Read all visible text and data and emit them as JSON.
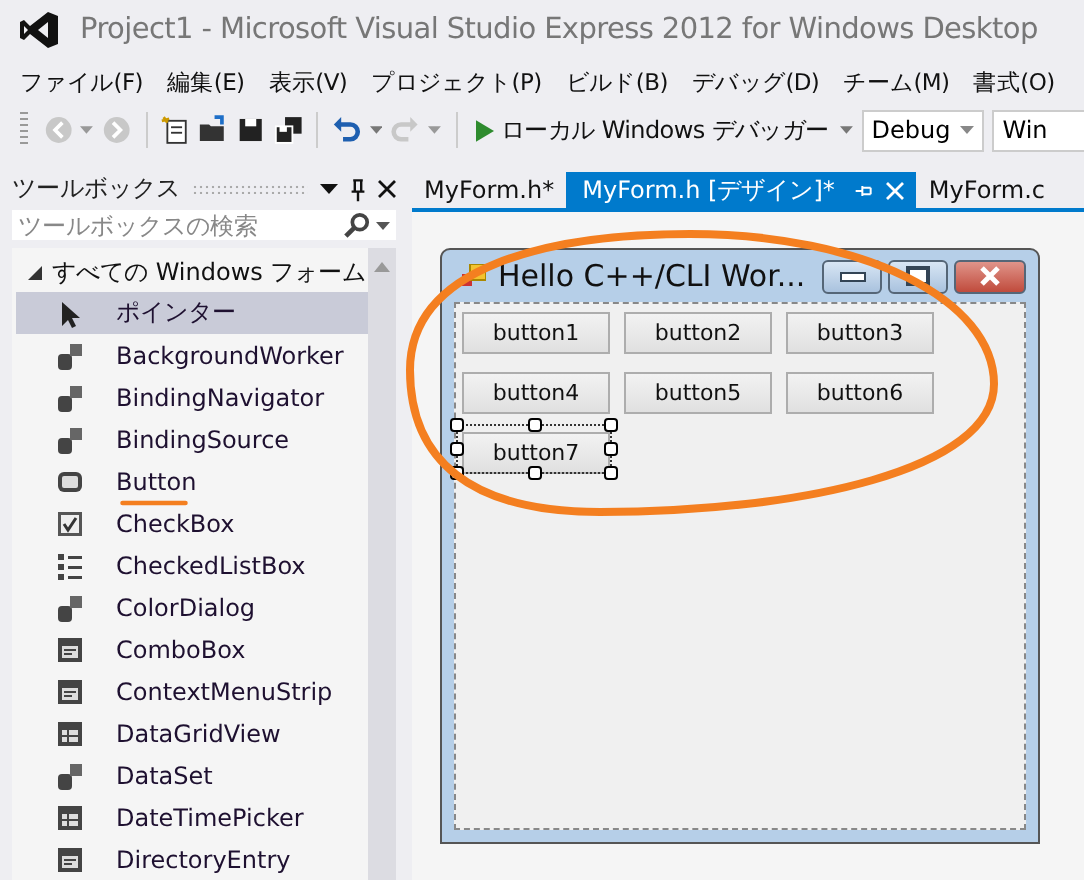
{
  "window": {
    "title": "Project1 - Microsoft Visual Studio Express 2012 for Windows Desktop"
  },
  "menu": [
    "ファイル(F)",
    "編集(E)",
    "表示(V)",
    "プロジェクト(P)",
    "ビルド(B)",
    "デバッグ(D)",
    "チーム(M)",
    "書式(O)"
  ],
  "toolbar": {
    "debugger": "ローカル Windows デバッガー",
    "configuration": "Debug",
    "platform": "Win"
  },
  "toolbox": {
    "title": "ツールボックス",
    "search": {
      "placeholder": "ツールボックスの検索"
    },
    "group": {
      "label": "すべての Windows フォーム",
      "expanded": true
    },
    "items": [
      {
        "label": "ポインター",
        "kind": "pointer",
        "selected": true
      },
      {
        "label": "BackgroundWorker",
        "kind": "component",
        "selected": false
      },
      {
        "label": "BindingNavigator",
        "kind": "component",
        "selected": false
      },
      {
        "label": "BindingSource",
        "kind": "component",
        "selected": false
      },
      {
        "label": "Button",
        "kind": "button",
        "selected": false
      },
      {
        "label": "CheckBox",
        "kind": "checkbox",
        "selected": false
      },
      {
        "label": "CheckedListBox",
        "kind": "list",
        "selected": false
      },
      {
        "label": "ColorDialog",
        "kind": "component",
        "selected": false
      },
      {
        "label": "ComboBox",
        "kind": "form",
        "selected": false
      },
      {
        "label": "ContextMenuStrip",
        "kind": "form",
        "selected": false
      },
      {
        "label": "DataGridView",
        "kind": "grid",
        "selected": false
      },
      {
        "label": "DataSet",
        "kind": "component",
        "selected": false
      },
      {
        "label": "DateTimePicker",
        "kind": "grid",
        "selected": false
      },
      {
        "label": "DirectoryEntry",
        "kind": "form",
        "selected": false
      }
    ]
  },
  "tabs": [
    {
      "label": "MyForm.h*",
      "selected": false
    },
    {
      "label": "MyForm.h [デザイン]*",
      "selected": true
    },
    {
      "label": "MyForm.c",
      "selected": false
    }
  ],
  "form": {
    "title": "Hello C++/CLI Wor...",
    "buttons": [
      {
        "label": "button1",
        "selected": false
      },
      {
        "label": "button2",
        "selected": false
      },
      {
        "label": "button3",
        "selected": false
      },
      {
        "label": "button4",
        "selected": false
      },
      {
        "label": "button5",
        "selected": false
      },
      {
        "label": "button6",
        "selected": false
      },
      {
        "label": "button7",
        "selected": true
      }
    ]
  }
}
